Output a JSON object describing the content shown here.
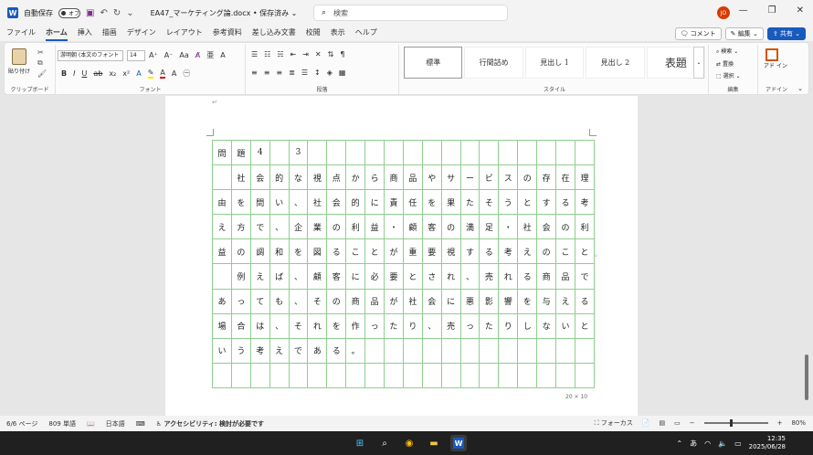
{
  "titlebar": {
    "autosave_label": "自動保存",
    "autosave_state": "オフ",
    "doc_title": "EA47_マーケティング論.docx • 保存済み ⌄",
    "search_placeholder": "検索",
    "avatar_initials": "JO"
  },
  "tabs": [
    "ファイル",
    "ホーム",
    "挿入",
    "描画",
    "デザイン",
    "レイアウト",
    "参考資料",
    "差し込み文書",
    "校閲",
    "表示",
    "ヘルプ"
  ],
  "tab_actions": {
    "comment": "コメント",
    "edit": "編集",
    "share": "共有"
  },
  "ribbon": {
    "clipboard": {
      "paste": "貼り付け",
      "label": "クリップボード"
    },
    "font": {
      "name": "游明朝 (本文のフォント",
      "size": "14",
      "label": "フォント"
    },
    "paragraph": {
      "label": "段落"
    },
    "styles": {
      "items": [
        "標準",
        "行間詰め",
        "見出し 1",
        "見出し 2",
        "表題"
      ],
      "label": "スタイル"
    },
    "editing": {
      "find": "検索",
      "replace": "置換",
      "select": "選択",
      "label": "編集"
    },
    "addin": {
      "name": "アド\nイン",
      "label": "アドイン"
    }
  },
  "document": {
    "rows": [
      [
        "問",
        "題",
        "4",
        "",
        "3",
        "",
        "",
        "",
        "",
        "",
        "",
        "",
        "",
        "",
        "",
        "",
        "",
        "",
        "",
        ""
      ],
      [
        "",
        "社",
        "会",
        "的",
        "な",
        "視",
        "点",
        "か",
        "ら",
        "商",
        "品",
        "や",
        "サ",
        "ー",
        "ビ",
        "ス",
        "の",
        "存",
        "在",
        "理"
      ],
      [
        "由",
        "を",
        "問",
        "い",
        "、",
        "社",
        "会",
        "的",
        "に",
        "責",
        "任",
        "を",
        "果",
        "た",
        "そ",
        "う",
        "と",
        "す",
        "る",
        "考"
      ],
      [
        "え",
        "方",
        "で",
        "、",
        "企",
        "業",
        "の",
        "利",
        "益",
        "・",
        "顧",
        "客",
        "の",
        "満",
        "足",
        "・",
        "社",
        "会",
        "の",
        "利"
      ],
      [
        "益",
        "の",
        "調",
        "和",
        "を",
        "図",
        "る",
        "こ",
        "と",
        "が",
        "重",
        "要",
        "視",
        "す",
        "る",
        "考",
        "え",
        "の",
        "こ",
        "と"
      ],
      [
        "",
        "例",
        "え",
        "ば",
        "、",
        "顧",
        "客",
        "に",
        "必",
        "要",
        "と",
        "さ",
        "れ",
        "、",
        "売",
        "れ",
        "る",
        "商",
        "品",
        "で"
      ],
      [
        "あ",
        "っ",
        "て",
        "も",
        "、",
        "そ",
        "の",
        "商",
        "品",
        "が",
        "社",
        "会",
        "に",
        "悪",
        "影",
        "響",
        "を",
        "与",
        "え",
        "る"
      ],
      [
        "場",
        "合",
        "は",
        "、",
        "そ",
        "れ",
        "を",
        "作",
        "っ",
        "た",
        "り",
        "、",
        "売",
        "っ",
        "た",
        "り",
        "し",
        "な",
        "い",
        "と"
      ],
      [
        "い",
        "う",
        "考",
        "え",
        "で",
        "あ",
        "る",
        "。",
        "",
        "",
        "",
        "",
        "",
        "",
        "",
        "",
        "",
        "",
        "",
        ""
      ],
      [
        "",
        "",
        "",
        "",
        "",
        "",
        "",
        "",
        "",
        "",
        "",
        "",
        "",
        "",
        "",
        "",
        "",
        "",
        "",
        ""
      ]
    ],
    "overflow_char": "。",
    "grid_label": "20 × 10"
  },
  "statusbar": {
    "page": "6/6 ページ",
    "words": "809 単語",
    "language": "日本語",
    "accessibility": "アクセシビリティ: 検討が必要です",
    "focus": "フォーカス",
    "zoom": "80%"
  },
  "taskbar": {
    "ime": "あ",
    "time": "12:35",
    "date": "2025/06/28"
  }
}
